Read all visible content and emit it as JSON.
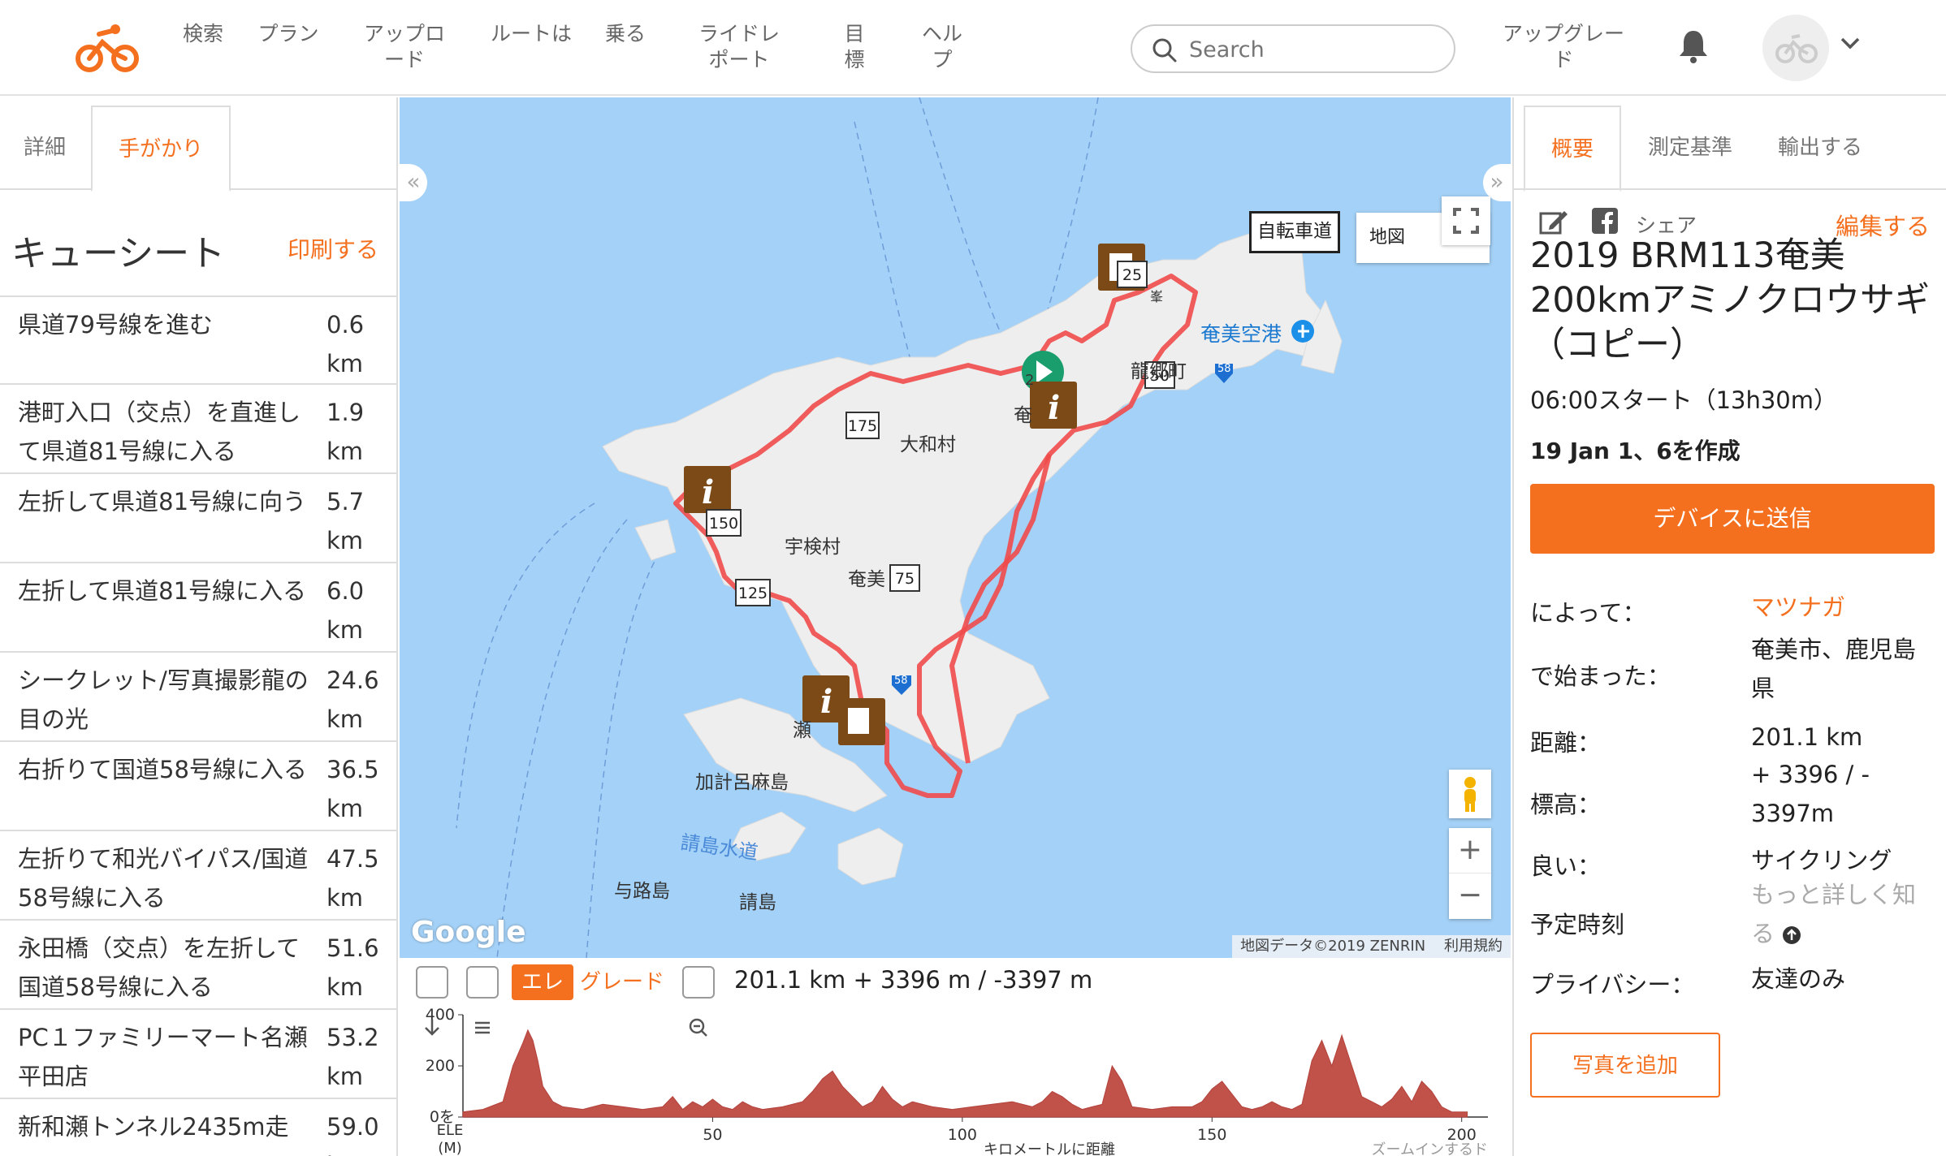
{
  "nav": {
    "items": [
      "検索",
      "プラン",
      "アップロード",
      "ルートは",
      "乗る",
      "ライドレポート",
      "目標",
      "ヘルプ"
    ],
    "search_placeholder": "Search",
    "upgrade": "アップグレード"
  },
  "left": {
    "tabs": [
      "詳細",
      "手がかり"
    ],
    "cue_title": "キューシート",
    "print": "印刷する",
    "cues": [
      {
        "text": "県道79号線を進む",
        "dist": "0.6 km"
      },
      {
        "text": "港町入口（交点）を直進して県道81号線に入る",
        "dist": "1.9 km"
      },
      {
        "text": "左折して県道81号線に向う",
        "dist": "5.7 km"
      },
      {
        "text": "左折して県道81号線に入る",
        "dist": "6.0 km"
      },
      {
        "text": "シークレット/写真撮影龍の目の光",
        "dist": "24.6 km"
      },
      {
        "text": "右折りて国道58号線に入る",
        "dist": "36.5 km"
      },
      {
        "text": "左折りて和光バイパス/国道58号線に入る",
        "dist": "47.5 km"
      },
      {
        "text": "永田橋（交点）を左折して国道58号線に入る",
        "dist": "51.6 km"
      },
      {
        "text": "PC１ファミリーマート名瀬平田店",
        "dist": "53.2 km"
      },
      {
        "text": "新和瀬トンネル2435m走",
        "dist": "59.0 km"
      }
    ]
  },
  "map": {
    "type_button": "自転車道",
    "type_select": "地図",
    "attribution": "地図データ©2019 ZENRIN",
    "terms": "利用規約",
    "google": "Google",
    "labels": {
      "airport": "奄美空港",
      "tatsugo": "龍郷町",
      "yamato": "大和村",
      "uken": "宇検村",
      "amami": "奄美",
      "kakeroma": "加計呂麻島",
      "channel": "請島水道",
      "yoro": "与路島",
      "uke": "請島",
      "setouchi": "瀬",
      "amami_mid": "奄",
      "hmm": "峯",
      "route_58a": "58",
      "route_58b": "58"
    },
    "markers": [
      "25",
      "50",
      "175",
      "150",
      "125",
      "75",
      "2"
    ],
    "collapse_left": "«",
    "collapse_right": "»"
  },
  "elevation": {
    "ele_tab": "エレ",
    "grade_tab": "グレード",
    "summary": "201.1 km + 3396 m / -3397 m",
    "y_ticks": [
      "400",
      "200",
      "0を"
    ],
    "x_ticks": [
      "50",
      "100",
      "150",
      "200"
    ],
    "y_label": "ELE",
    "y_unit": "(M)",
    "x_label": "キロメートルに距離",
    "zoom_hint": "ズームインするド"
  },
  "elevation_profile": {
    "x_km": [
      0,
      4,
      8,
      10,
      12,
      13,
      14,
      15,
      16,
      18,
      20,
      24,
      28,
      32,
      36,
      40,
      42,
      44,
      46,
      48,
      50,
      52,
      54,
      56,
      58,
      60,
      64,
      68,
      70,
      72,
      74,
      76,
      78,
      80,
      82,
      84,
      86,
      88,
      90,
      94,
      98,
      102,
      106,
      110,
      114,
      116,
      118,
      120,
      122,
      124,
      126,
      128,
      130,
      132,
      134,
      138,
      142,
      146,
      148,
      150,
      152,
      154,
      156,
      158,
      160,
      162,
      164,
      166,
      168,
      170,
      172,
      174,
      176,
      178,
      180,
      182,
      184,
      186,
      188,
      190,
      192,
      194,
      196,
      198,
      200,
      201.1
    ],
    "ele_m": [
      20,
      30,
      60,
      200,
      290,
      340,
      300,
      220,
      120,
      60,
      40,
      30,
      50,
      40,
      30,
      40,
      80,
      30,
      60,
      40,
      70,
      40,
      30,
      60,
      40,
      30,
      40,
      60,
      100,
      150,
      180,
      120,
      80,
      40,
      60,
      120,
      70,
      40,
      60,
      40,
      30,
      40,
      50,
      60,
      40,
      60,
      100,
      80,
      50,
      30,
      40,
      50,
      200,
      140,
      40,
      30,
      40,
      40,
      60,
      110,
      140,
      90,
      40,
      30,
      40,
      60,
      40,
      30,
      50,
      220,
      300,
      200,
      320,
      200,
      80,
      60,
      40,
      70,
      120,
      60,
      140,
      100,
      40,
      20,
      20,
      20
    ]
  },
  "right": {
    "tabs": [
      "概要",
      "測定基準",
      "輸出する"
    ],
    "share": "シェア",
    "edit": "編集する",
    "title": "2019 BRM113奄美200kmアミノクロウサギ（コピー）",
    "start_time": "06:00スタート（13h30m）",
    "created": "19 Jan 1、6を作成",
    "send_button": "デバイスに送信",
    "info": [
      {
        "key": "によって：",
        "val": "マツナガ"
      },
      {
        "key": "で始まった：",
        "val": "奄美市、鹿児島県"
      },
      {
        "key": "距離：",
        "val": "201.1 km"
      },
      {
        "key": "標高：",
        "val": "+ 3396 / - 3397m"
      },
      {
        "key": "良い：",
        "val": "サイクリング"
      },
      {
        "key": "予定時刻",
        "val": "もっと詳しく知る"
      },
      {
        "key": "プライバシー：",
        "val": "友達のみ"
      }
    ],
    "photo_button": "写真を追加"
  },
  "colors": {
    "accent": "#f4701f",
    "route": "#ef4a4a",
    "sea": "#a4d1f7",
    "land": "#eeeeee"
  }
}
